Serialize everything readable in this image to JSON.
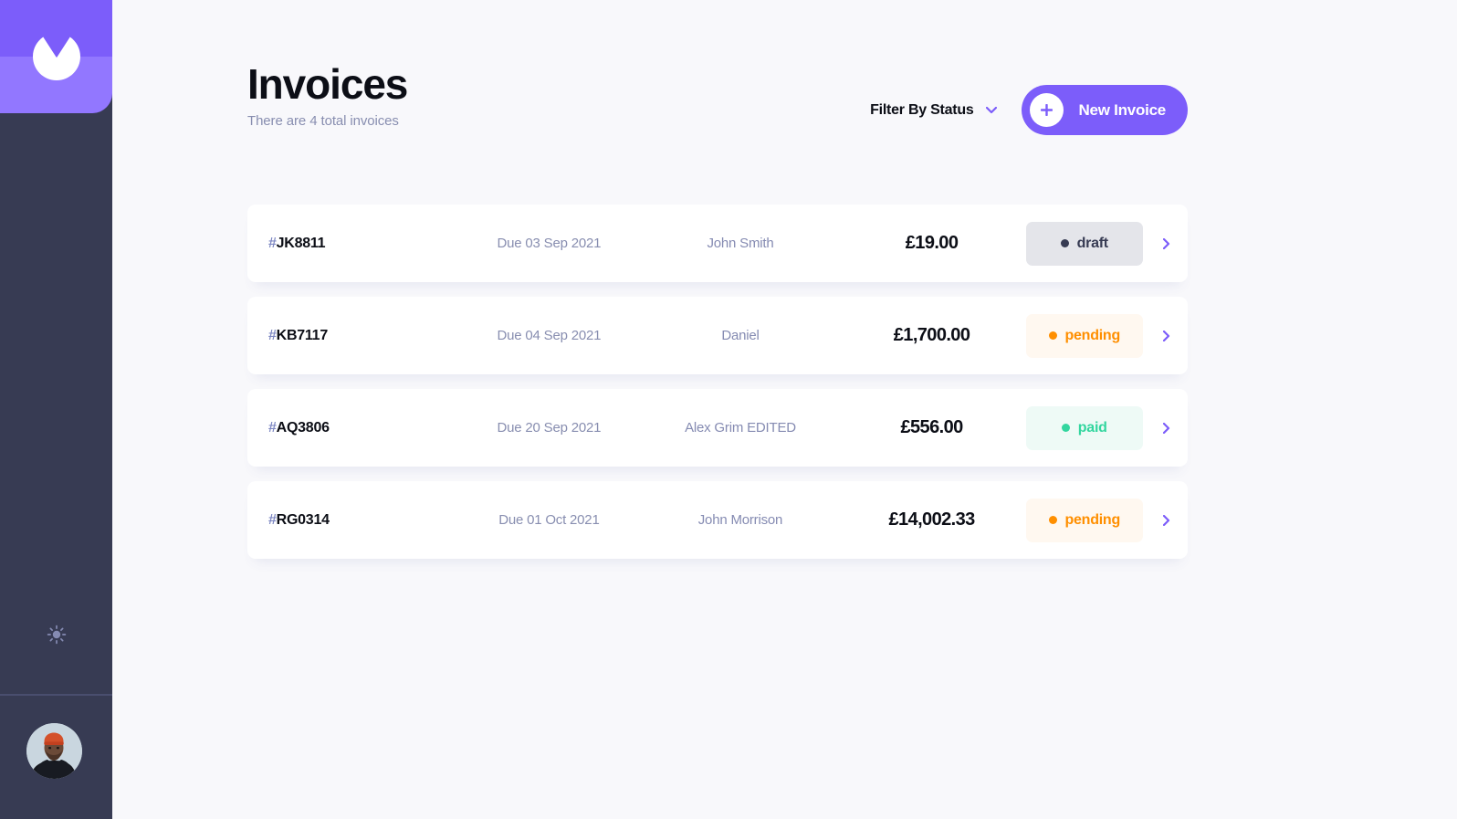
{
  "app": {
    "name": "Invoice App",
    "theme_colors": {
      "accent": "#7c5dfa",
      "accent_light": "#9277ff",
      "sidebar": "#373b53",
      "page_background": "#f8f8fb",
      "card": "#ffffff",
      "text_dark": "#0c0e16",
      "text_muted": "#888eb0",
      "draft": "#373b53",
      "pending": "#ff8f00",
      "paid": "#33d69f"
    }
  },
  "sidebar": {
    "logo_name": "app-logo",
    "theme_toggle_icon": "sun-icon",
    "avatar_label": "user-avatar"
  },
  "header": {
    "title": "Invoices",
    "subtitle": "There are 4 total invoices",
    "filter_label": "Filter By Status",
    "filter_icon": "chevron-down-icon",
    "new_invoice_label": "New Invoice",
    "new_invoice_icon": "plus-icon"
  },
  "invoices": [
    {
      "hash": "#",
      "id": "JK8811",
      "due_date": "Due 03 Sep 2021",
      "client": "John Smith",
      "amount": "£19.00",
      "status": "draft",
      "status_class": "status-draft"
    },
    {
      "hash": "#",
      "id": "KB7117",
      "due_date": "Due 04 Sep 2021",
      "client": "Daniel",
      "amount": "£1,700.00",
      "status": "pending",
      "status_class": "status-pending"
    },
    {
      "hash": "#",
      "id": "AQ3806",
      "due_date": "Due 20 Sep 2021",
      "client": "Alex Grim EDITED",
      "amount": "£556.00",
      "status": "paid",
      "status_class": "status-paid"
    },
    {
      "hash": "#",
      "id": "RG0314",
      "due_date": "Due 01 Oct 2021",
      "client": "John Morrison",
      "amount": "£14,002.33",
      "status": "pending",
      "status_class": "status-pending"
    }
  ]
}
